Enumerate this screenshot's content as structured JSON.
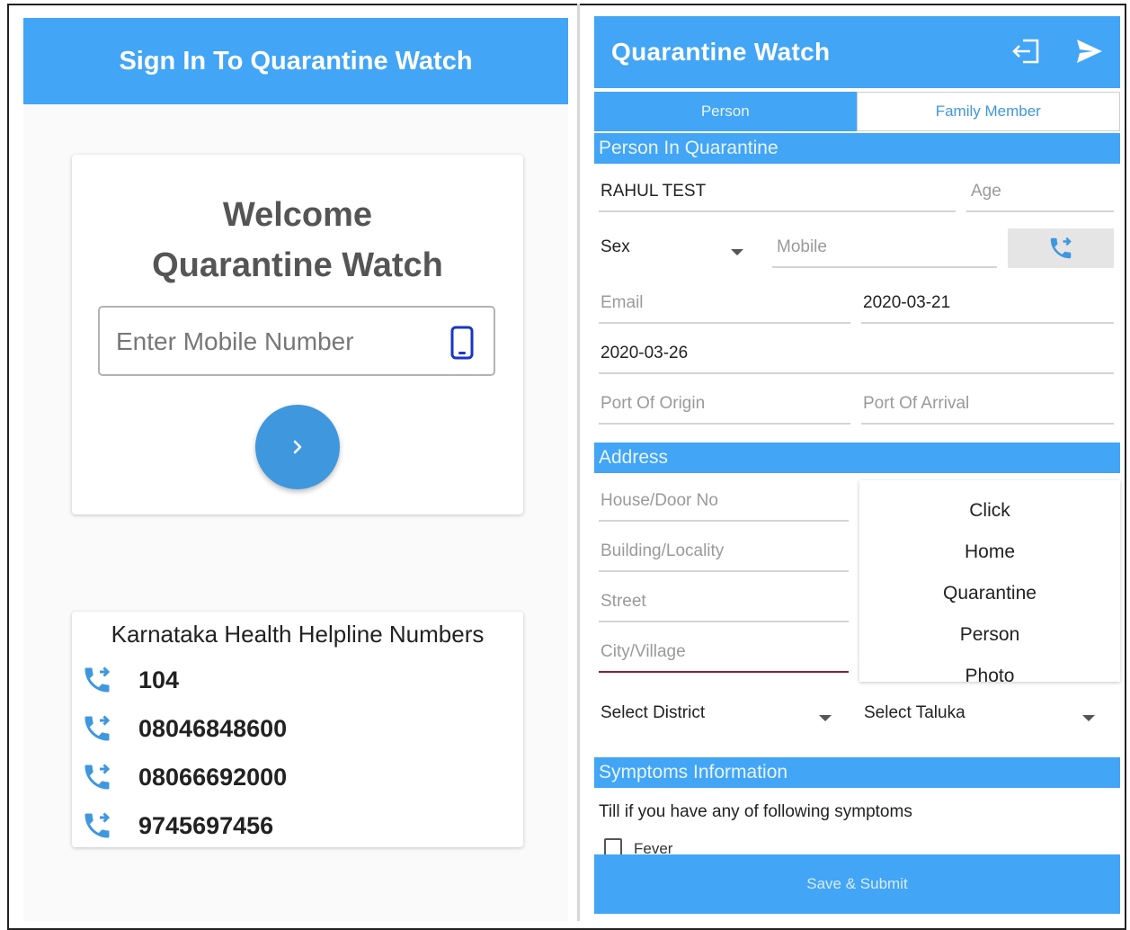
{
  "colors": {
    "primary": "#42a5f5",
    "button": "#3f97de",
    "icon": "#3f97de",
    "phone_icon": "#1a36c4"
  },
  "signin": {
    "title": "Sign In To Quarantine Watch",
    "welcome_line1": "Welcome",
    "welcome_line2": "Quarantine Watch",
    "mobile_placeholder": "Enter Mobile Number",
    "mobile_value": "",
    "next_icon": "chevron-right-icon"
  },
  "helpline": {
    "title": "Karnataka Health Helpline Numbers",
    "numbers": [
      "104",
      "08046848600",
      "08066692000",
      "9745697456"
    ],
    "icon": "phone-forward-icon"
  },
  "form": {
    "app_title": "Quarantine Watch",
    "header_icons": [
      "logout-icon",
      "send-icon"
    ],
    "tabs": [
      {
        "label": "Person",
        "active": true
      },
      {
        "label": "Family Member",
        "active": false
      }
    ],
    "person_section": "Person In Quarantine",
    "name_value": "RAHUL TEST",
    "age_placeholder": "Age",
    "sex_label": "Sex",
    "mobile_placeholder": "Mobile",
    "email_placeholder": "Email",
    "date1": "2020-03-21",
    "date2": "2020-03-26",
    "port_origin_placeholder": "Port Of Origin",
    "port_arrival_placeholder": "Port Of Arrival",
    "address_section": "Address",
    "house_placeholder": "House/Door No",
    "building_placeholder": "Building/Locality",
    "street_placeholder": "Street",
    "city_placeholder": "City/Village",
    "photo_lines": [
      "Click",
      "Home",
      "Quarantine",
      "Person",
      "Photo"
    ],
    "district_label": "Select District",
    "taluka_label": "Select Taluka",
    "symptoms_section": "Symptoms Information",
    "symptoms_prompt": "Till if you have any of following symptoms",
    "fever_label": "Fever",
    "fever_checked": false,
    "submit_label": "Save & Submit"
  }
}
